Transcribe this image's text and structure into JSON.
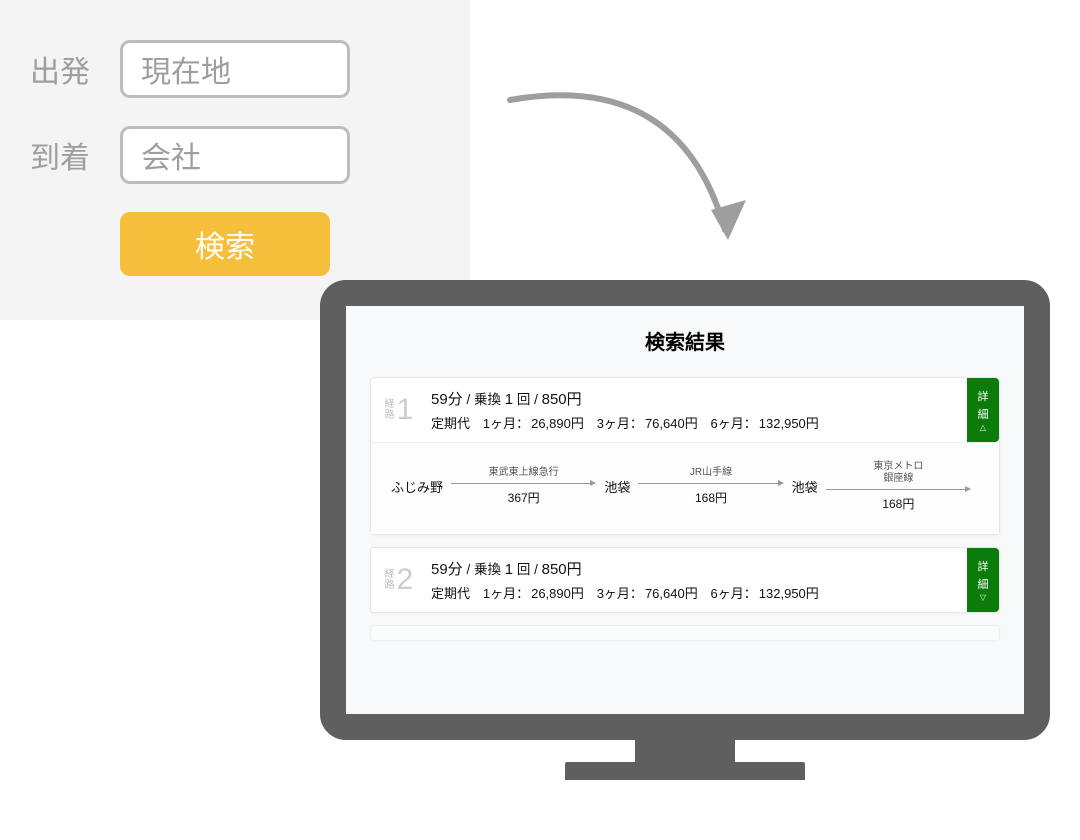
{
  "search_form": {
    "departure_label": "出発",
    "departure_value": "現在地",
    "arrival_label": "到着",
    "arrival_value": "会社",
    "search_button": "検索"
  },
  "results": {
    "title": "検索結果",
    "route_label_top": "経",
    "route_label_bottom": "路",
    "detail_char1": "詳",
    "detail_char2": "細",
    "routes": [
      {
        "number": "1",
        "summary_duration": "59分",
        "summary_transfer_label": "乗換",
        "summary_transfer_count": "1",
        "summary_transfer_unit": "回",
        "summary_fare": "850円",
        "pass_label": "定期代",
        "pass_1m_label": "1ヶ月：",
        "pass_1m": "26,890円",
        "pass_3m_label": "3ヶ月：",
        "pass_3m": "76,640円",
        "pass_6m_label": "6ヶ月：",
        "pass_6m": "132,950円",
        "expanded": true,
        "segments": {
          "stations": [
            "ふじみ野",
            "池袋",
            "池袋",
            ""
          ],
          "legs": [
            {
              "line": "東武東上線急行",
              "fare": "367円"
            },
            {
              "line": "JR山手線",
              "fare": "168円"
            },
            {
              "line_l1": "東京メトロ",
              "line_l2": "銀座線",
              "fare": "168円"
            }
          ]
        }
      },
      {
        "number": "2",
        "summary_duration": "59分",
        "summary_transfer_label": "乗換",
        "summary_transfer_count": "1",
        "summary_transfer_unit": "回",
        "summary_fare": "850円",
        "pass_label": "定期代",
        "pass_1m_label": "1ヶ月：",
        "pass_1m": "26,890円",
        "pass_3m_label": "3ヶ月：",
        "pass_3m": "76,640円",
        "pass_6m_label": "6ヶ月：",
        "pass_6m": "132,950円",
        "expanded": false
      }
    ]
  }
}
